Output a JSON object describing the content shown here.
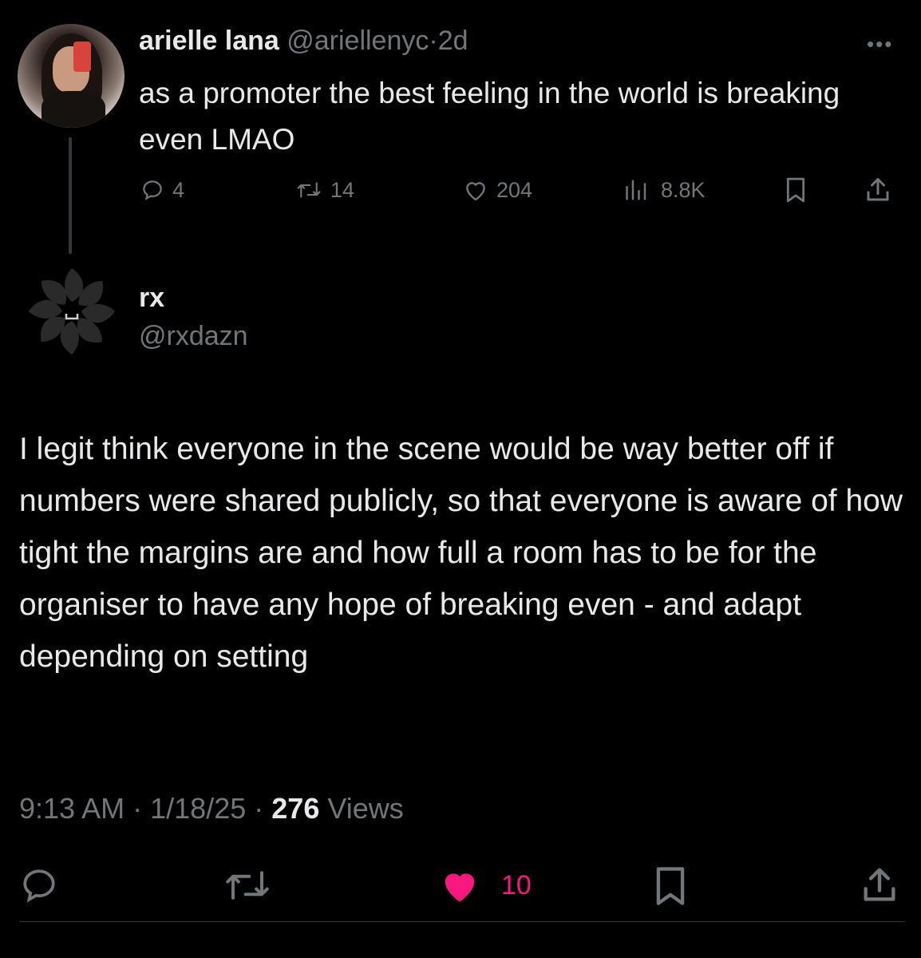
{
  "original_tweet": {
    "display_name": "arielle lana",
    "handle": "@ariellenyc",
    "separator": "·",
    "time_ago": "2d",
    "more_icon": "more-icon",
    "text": "as a promoter the best feeling in the world is breaking even LMAO",
    "replies": "4",
    "reposts": "14",
    "likes": "204",
    "views": "8.8K"
  },
  "reply_tweet": {
    "display_name": "rx",
    "handle": "@rxdazn",
    "text": "I legit think everyone in the scene would be way better off if numbers were shared publicly, so that everyone is aware of how tight the margins are and how full a room has to be for the organiser to have any hope of breaking even - and adapt depending on setting",
    "time": "9:13 AM",
    "date": "1/18/25",
    "sep": "·",
    "view_count": "276",
    "views_label": "Views",
    "likes": "10"
  },
  "colors": {
    "background": "#000000",
    "text": "#e7e9ea",
    "muted": "#71767b",
    "like_active": "#f91880"
  }
}
